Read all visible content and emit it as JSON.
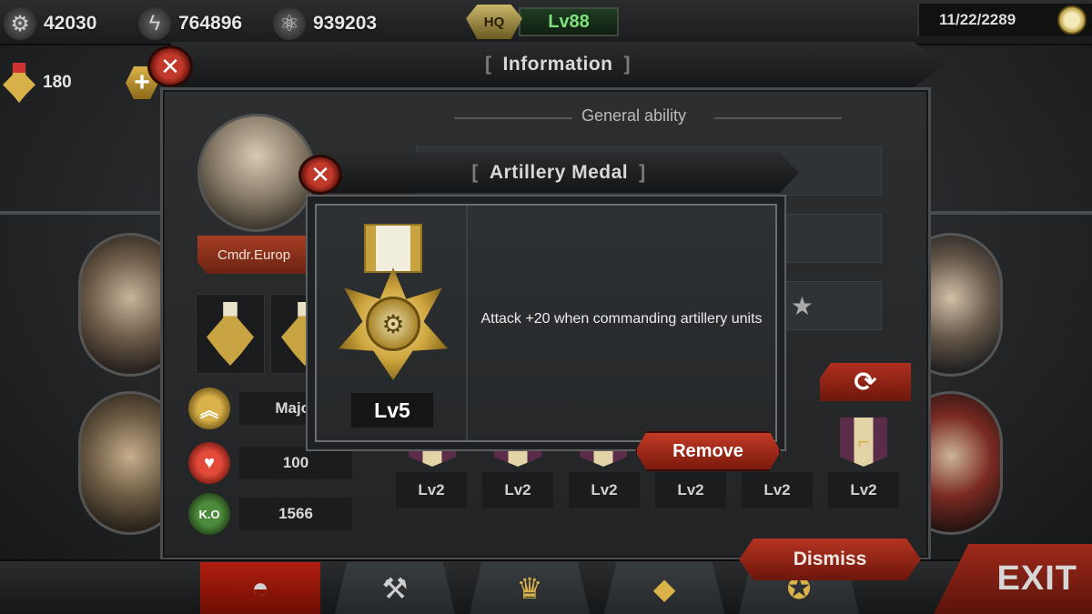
{
  "top_bar": {
    "gears": "42030",
    "energy": "764896",
    "atoms": "939203",
    "hq_badge": "HQ",
    "hq_level": "Lv88",
    "date": "11/22/2289"
  },
  "medals_resource": {
    "count": "180",
    "plus_label": "+"
  },
  "info": {
    "title": "Information",
    "ability_title": "General ability",
    "commander_name": "Cmdr.Europ",
    "rank": "Major",
    "health": "100",
    "kills": "1566",
    "ko_label": "K.O",
    "medal_levels": [
      "Lv2",
      "Lv2",
      "Lv2",
      "Lv2",
      "Lv2",
      "Lv2"
    ]
  },
  "popup": {
    "title": "Artillery Medal",
    "level": "Lv5",
    "description": "Attack +20 when commanding artillery units",
    "remove_label": "Remove"
  },
  "actions": {
    "dismiss_label": "Dismiss",
    "exit_label": "EXIT"
  },
  "icons": {
    "gear": "gear-icon",
    "energy": "lightning-icon",
    "atom": "atom-icon",
    "clock": "clock-icon",
    "close": "close-icon",
    "refresh": "refresh-icon",
    "heart": "heart-icon",
    "helmet": "helmet-icon",
    "rank": "chevron-rank-icon",
    "star": "star-icon"
  },
  "colors": {
    "accent_red": "#b63322",
    "gold": "#cfa63e",
    "hq_green": "#7fe07d"
  }
}
